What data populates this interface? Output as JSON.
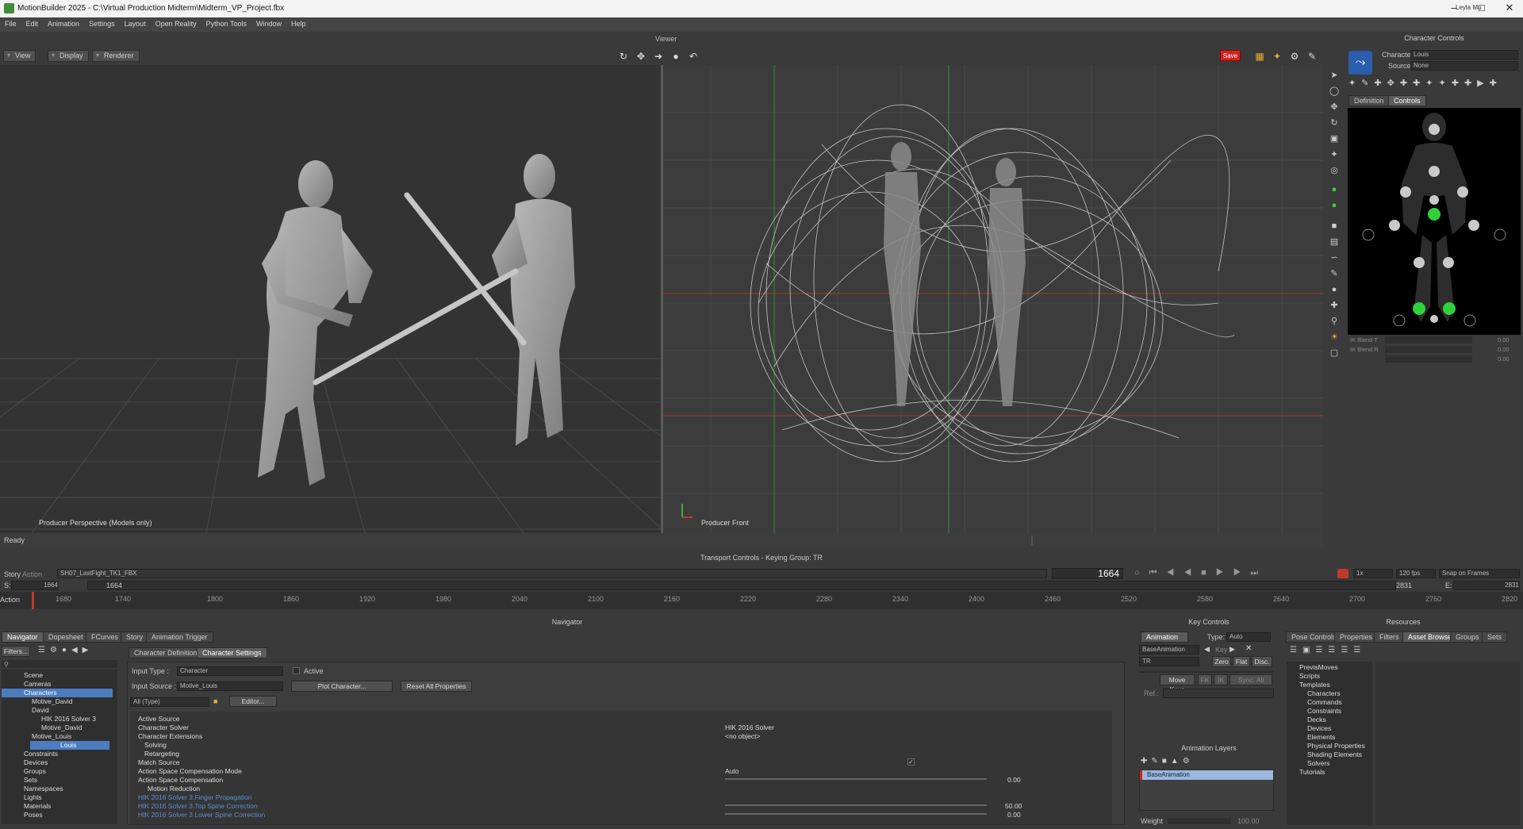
{
  "window": {
    "title": "MotionBuilder 2025 - C:\\Virtual Production Midterm\\Midterm_VP_Project.fbx",
    "user": "Leyla Mu"
  },
  "menu": [
    "File",
    "Edit",
    "Animation",
    "Settings",
    "Layout",
    "Open Reality",
    "Python Tools",
    "Window",
    "Help"
  ],
  "viewer": {
    "label": "Viewer",
    "buttons": {
      "view": "View",
      "display": "Display",
      "renderer": "Renderer"
    },
    "save_label": "Save",
    "left_label": "Producer Perspective (Models only)",
    "right_label": "Producer Front",
    "status": "Ready"
  },
  "character_controls": {
    "title": "Character Controls",
    "character_label": "Character:",
    "character_value": "Louis",
    "source_label": "Source:",
    "source_value": "None",
    "tabs": [
      "Definition",
      "Controls"
    ],
    "ik_blend_t": "IK Blend T",
    "ik_blend_r": "IK Blend R",
    "ik_t_val": "0.00",
    "ik_r_val": "0.00",
    "ik_3_val": "0.00"
  },
  "transport": {
    "title": "Transport Controls  -  Keying Group: TR",
    "story_label": "Story",
    "action_label": "Action",
    "take": "SH07_LastFight_TK1_FBX",
    "frame_display": "1664",
    "frame_start": "1664",
    "frame_start2": "1664",
    "end1": "2831",
    "end2": "2831",
    "speed": "1x",
    "fps": "120 fps",
    "snap": "Snap on Frames",
    "s_label": "S:",
    "e_label": "E:",
    "ticks": [
      "1680",
      "1740",
      "1800",
      "1860",
      "1920",
      "1980",
      "2040",
      "2100",
      "2160",
      "2220",
      "2280",
      "2340",
      "2400",
      "2460",
      "2520",
      "2580",
      "2640",
      "2700",
      "2760",
      "2820"
    ]
  },
  "navigator": {
    "title": "Navigator",
    "tabs": [
      "Navigator",
      "Dopesheet",
      "FCurves",
      "Story",
      "Animation Trigger"
    ],
    "filters": "Filters...",
    "tree": [
      {
        "label": "Scene",
        "indent": 0,
        "sel": true
      },
      {
        "label": "Cameras",
        "indent": 1,
        "sel": false
      },
      {
        "label": "Characters",
        "indent": 1,
        "sel": true
      },
      {
        "label": "Motive_David",
        "indent": 2,
        "sel": false
      },
      {
        "label": "David",
        "indent": 2,
        "sel": false
      },
      {
        "label": "HIK 2016 Solver 3",
        "indent": 3,
        "sel": false
      },
      {
        "label": "Motive_David",
        "indent": 3,
        "sel": false
      },
      {
        "label": "Motive_Louis",
        "indent": 2,
        "sel": false
      },
      {
        "label": "Louis",
        "indent": 2,
        "sel": true
      },
      {
        "label": "Constraints",
        "indent": 0,
        "sel": false
      },
      {
        "label": "Devices",
        "indent": 0,
        "sel": false
      },
      {
        "label": "Groups",
        "indent": 0,
        "sel": false
      },
      {
        "label": "Sets",
        "indent": 0,
        "sel": false
      },
      {
        "label": "Namespaces",
        "indent": 0,
        "sel": false
      },
      {
        "label": "Lights",
        "indent": 0,
        "sel": false
      },
      {
        "label": "Materials",
        "indent": 0,
        "sel": false
      },
      {
        "label": "Poses",
        "indent": 0,
        "sel": false
      }
    ],
    "char_tabs": [
      "Character Definition",
      "Character Settings"
    ],
    "input_type_label": "Input Type :",
    "input_type_value": "Character",
    "active_label": "Active",
    "input_source_label": "Input Source :",
    "input_source_value": "Motive_Louis",
    "plot_button": "Plot Character...",
    "reset_button": "Reset All Properties",
    "filter_value": "All (Type)",
    "editor_button": "Editor...",
    "props": [
      {
        "label": "Active Source",
        "indent": 0,
        "value": "",
        "blue": false
      },
      {
        "label": "Character Solver",
        "indent": 0,
        "value": "HIK 2016 Solver",
        "blue": false
      },
      {
        "label": "Character Extensions",
        "indent": 0,
        "value": "<no object>",
        "blue": false
      },
      {
        "label": "Solving",
        "indent": 1,
        "value": "",
        "blue": false
      },
      {
        "label": "Retargeting",
        "indent": 1,
        "value": "",
        "blue": false
      },
      {
        "label": "Match Source",
        "indent": 0,
        "value": "",
        "blue": false
      },
      {
        "label": "Action Space Compensation Mode",
        "indent": 0,
        "value": "Auto",
        "blue": false
      },
      {
        "label": "Action Space Compensation",
        "indent": 0,
        "value": "0.00",
        "blue": false
      },
      {
        "label": "Motion Reduction",
        "indent": 1,
        "value": "",
        "blue": false
      },
      {
        "label": "HIK 2016 Solver 3.Finger Propagation",
        "indent": 0,
        "value": "",
        "blue": true
      },
      {
        "label": "HIK 2016 Solver 3.Top Spine Correction",
        "indent": 0,
        "value": "50.00",
        "blue": true
      },
      {
        "label": "HIK 2016 Solver 3.Lower Spine Correction",
        "indent": 0,
        "value": "0.00",
        "blue": true
      }
    ]
  },
  "key_controls": {
    "title": "Key Controls",
    "animation_tab": "Animation",
    "type_label": "Type:",
    "type_value": "Auto",
    "layer_value": "BaseAnimation",
    "key_label": "Key",
    "tr_value": "TR",
    "zero": "Zero",
    "flat": "Flat",
    "disc": "Disc.",
    "move_keys": "Move Keys",
    "fk": "FK",
    "ik": "IK",
    "sync": "Sync. All",
    "ref_label": "Ref.:",
    "layers_title": "Animation Layers",
    "layer_row": "BaseAnimation",
    "weight_label": "Weight",
    "weight_value": "100.00"
  },
  "resources": {
    "title": "Resources",
    "tabs": [
      "Pose Controls",
      "Properties",
      "Filters",
      "Asset Browser",
      "Groups",
      "Sets"
    ],
    "tree": [
      {
        "label": "PrevisMoves",
        "indent": 0
      },
      {
        "label": "Scripts",
        "indent": 0
      },
      {
        "label": "Templates",
        "indent": 0
      },
      {
        "label": "Characters",
        "indent": 1
      },
      {
        "label": "Commands",
        "indent": 1
      },
      {
        "label": "Constraints",
        "indent": 1
      },
      {
        "label": "Decks",
        "indent": 1
      },
      {
        "label": "Devices",
        "indent": 1
      },
      {
        "label": "Elements",
        "indent": 1
      },
      {
        "label": "Physical Properties",
        "indent": 1
      },
      {
        "label": "Shading Elements",
        "indent": 1
      },
      {
        "label": "Solvers",
        "indent": 1
      },
      {
        "label": "Tutorials",
        "indent": 0
      }
    ]
  }
}
